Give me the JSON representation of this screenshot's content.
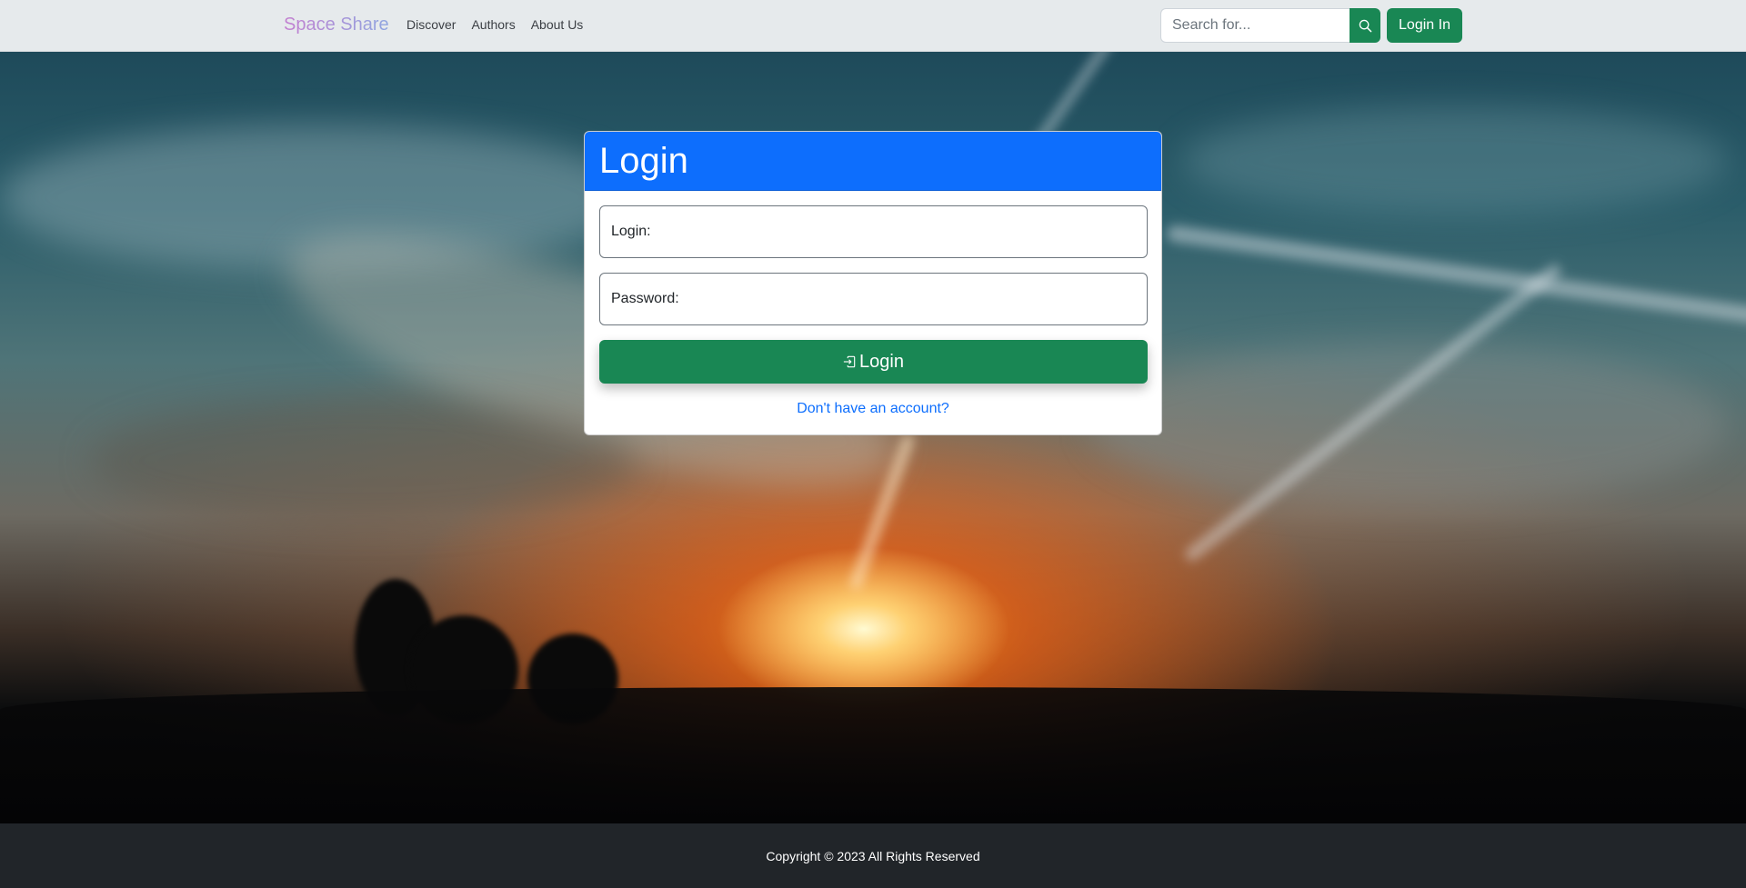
{
  "navbar": {
    "brand": "Space Share",
    "links": [
      "Discover",
      "Authors",
      "About Us"
    ],
    "search_placeholder": "Search for...",
    "login_button": "Login In"
  },
  "login_card": {
    "title": "Login",
    "login_label": "Login:",
    "password_label": "Password:",
    "submit_label": "Login",
    "signup_link": "Don't have an account?"
  },
  "footer": {
    "copyright": "Copyright © 2023 All Rights Reserved"
  },
  "colors": {
    "primary": "#0d6efd",
    "success": "#198754",
    "footer_bg": "#212529",
    "navbar_bg": "#e6eaec"
  },
  "icons": {
    "search": "search-icon",
    "login": "box-arrow-in-right-icon"
  }
}
